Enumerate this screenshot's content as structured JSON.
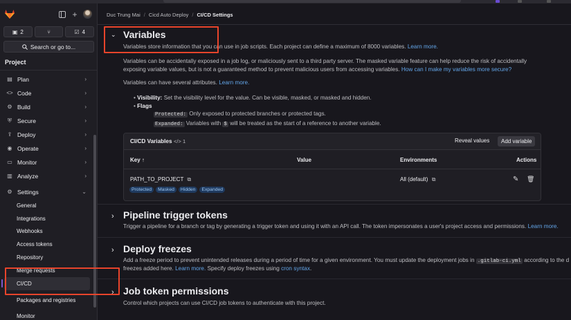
{
  "sidebar": {
    "counters": [
      {
        "icon": "issues-icon",
        "value": "2"
      },
      {
        "icon": "merge-request-icon",
        "value": ""
      },
      {
        "icon": "todo-icon",
        "value": "4"
      }
    ],
    "search_label": "Search or go to...",
    "section": "Project",
    "nav": [
      {
        "label": "Plan",
        "icon": "plan-icon"
      },
      {
        "label": "Code",
        "icon": "code-icon"
      },
      {
        "label": "Build",
        "icon": "build-icon"
      },
      {
        "label": "Secure",
        "icon": "shield-icon"
      },
      {
        "label": "Deploy",
        "icon": "deploy-icon"
      },
      {
        "label": "Operate",
        "icon": "operate-icon"
      },
      {
        "label": "Monitor",
        "icon": "monitor-icon"
      },
      {
        "label": "Analyze",
        "icon": "chart-icon"
      },
      {
        "label": "Settings",
        "icon": "gear-icon"
      }
    ],
    "settings_sub": [
      "General",
      "Integrations",
      "Webhooks",
      "Access tokens",
      "Repository",
      "Merge requests",
      "CI/CD",
      "Packages and registries",
      "Monitor"
    ]
  },
  "breadcrumb": [
    "Duc Trung Mai",
    "Cicd Auto Deploy",
    "CI/CD Settings"
  ],
  "variables": {
    "title": "Variables",
    "desc": "Variables store information that you can use in job scripts. Each project can define a maximum of 8000 variables.",
    "learn_more": "Learn more.",
    "p1_line1": "Variables can be accidentally exposed in a job log, or maliciously sent to a third party server. The masked variable feature can help reduce the risk of accidentally",
    "p1_line2": "exposing variable values, but is not a guaranteed method to prevent malicious users from accessing variables.",
    "p1_link": "How can I make my variables more secure?",
    "p2": "Variables can have several attributes.",
    "visibility_label": "Visibility:",
    "visibility_text": "Set the visibility level for the value. Can be visible, masked, or masked and hidden.",
    "flags_label": "Flags",
    "protected_code": "Protected:",
    "protected_text": "Only exposed to protected branches or protected tags.",
    "expanded_code": "Expanded:",
    "expanded_text_1": "Variables with",
    "dollar_code": "$",
    "expanded_text_2": "will be treated as the start of a reference to another variable.",
    "card": {
      "title": "CI/CD Variables",
      "count": "1",
      "reveal": "Reveal values",
      "add": "Add variable",
      "columns": [
        "Key",
        "Value",
        "Environments",
        "Actions"
      ],
      "row": {
        "key": "PATH_TO_PROJECT",
        "environment": "All (default)",
        "badges": [
          "Protected",
          "Masked",
          "Hidden",
          "Expanded"
        ]
      }
    }
  },
  "pipeline": {
    "title": "Pipeline trigger tokens",
    "desc": "Trigger a pipeline for a branch or tag by generating a trigger token and using it with an API call. The token impersonates a user's project access and permissions.",
    "link": "Learn more."
  },
  "freezes": {
    "title": "Deploy freezes",
    "desc_1": "Add a freeze period to prevent unintended releases during a period of time for a given environment. You must update the deployment jobs in",
    "code": ".gitlab-ci.yml",
    "desc_2": "according to the d",
    "line2_1": "freezes added here.",
    "link1": "Learn more.",
    "line2_2": "Specify deploy freezes using",
    "link2": "cron syntax",
    "line2_3": "."
  },
  "job_token": {
    "title": "Job token permissions",
    "desc": "Control which projects can use CI/CD job tokens to authenticate with this project."
  },
  "colors": {
    "accent": "#7b58cf",
    "link": "#63a6e9",
    "highlight": "#e8442b",
    "badge_bg": "#1f3a5f"
  }
}
